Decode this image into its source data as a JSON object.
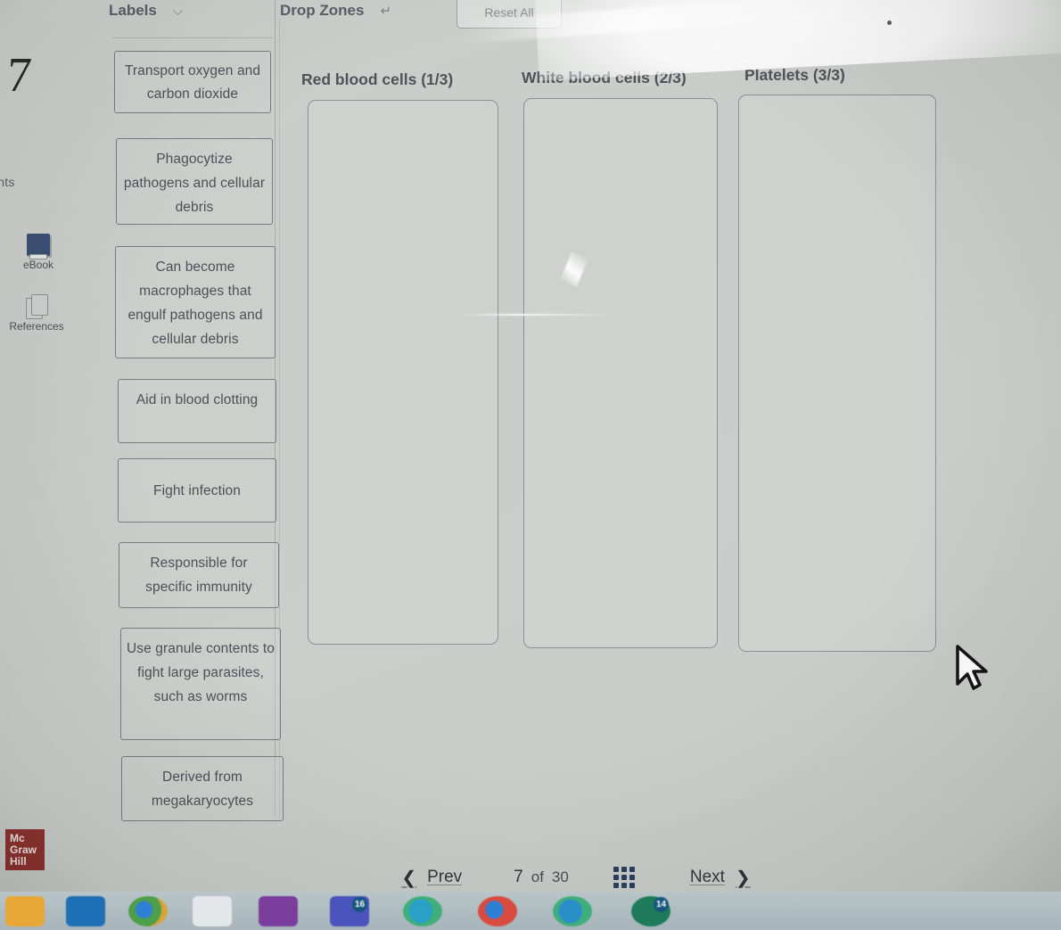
{
  "page": {
    "number": "7",
    "points_label": "oints"
  },
  "rail": {
    "tools": [
      {
        "name": "ebook",
        "label": "eBook",
        "icon": "book-icon"
      },
      {
        "name": "references",
        "label": "References",
        "icon": "documents-icon"
      }
    ],
    "brand": "Mc Graw Hill"
  },
  "header": {
    "labels_title": "Labels",
    "labels_icon": "chevron-down-circle-icon",
    "zones_title": "Drop Zones",
    "zones_icon": "undo-arrow-icon",
    "reset_button": "Reset All"
  },
  "labels": [
    {
      "text": "Transport oxygen and carbon dioxide"
    },
    {
      "text": "Phagocytize pathogens and cellular debris"
    },
    {
      "text": "Can become macrophages that engulf pathogens and cellular debris"
    },
    {
      "text": "Aid in blood clotting"
    },
    {
      "text": "Fight infection"
    },
    {
      "text": "Responsible for specific immunity"
    },
    {
      "text": "Use granule contents to fight large parasites, such as worms"
    },
    {
      "text": "Derived from megakaryocytes"
    }
  ],
  "drop_zones": [
    {
      "title": "Red blood cells (1/3)",
      "items": []
    },
    {
      "title": "White blood cells (2/3)",
      "items": []
    },
    {
      "title": "Platelets (3/3)",
      "items": []
    }
  ],
  "bottom_nav": {
    "prev_label": "Prev",
    "next_label": "Next",
    "current_page": "7",
    "of_word": "of",
    "total_pages": "30",
    "grid_icon": "grid-menu-icon",
    "prev_chevron": "❮",
    "next_chevron": "❯"
  },
  "taskbar": {
    "items": [
      {
        "name": "file-explorer",
        "color": "#e8a838",
        "badge": ""
      },
      {
        "name": "outlook",
        "color": "#1f6fb5",
        "badge": ""
      },
      {
        "name": "chrome-profile",
        "color": "#4d8b49",
        "badge": ""
      },
      {
        "name": "word-document",
        "color": "#dfe3e6",
        "badge": ""
      },
      {
        "name": "onenote",
        "color": "#7a3f9d",
        "badge": ""
      },
      {
        "name": "teams",
        "color": "#4b53bc",
        "badge": "16"
      },
      {
        "name": "edge",
        "color": "#2e9bc4",
        "badge": ""
      },
      {
        "name": "chrome",
        "color": "#d94b3f",
        "badge": ""
      },
      {
        "name": "edge-secondary",
        "color": "#2e9bc4",
        "badge": ""
      },
      {
        "name": "messaging-app",
        "color": "#1d7a5a",
        "badge": "14"
      }
    ]
  },
  "colors": {
    "screen_bg": "#cbcecb",
    "card_border": "#787d84",
    "text": "#4d5157",
    "brand_red": "#8f3430",
    "grid_icon": "#2c3f5e"
  }
}
